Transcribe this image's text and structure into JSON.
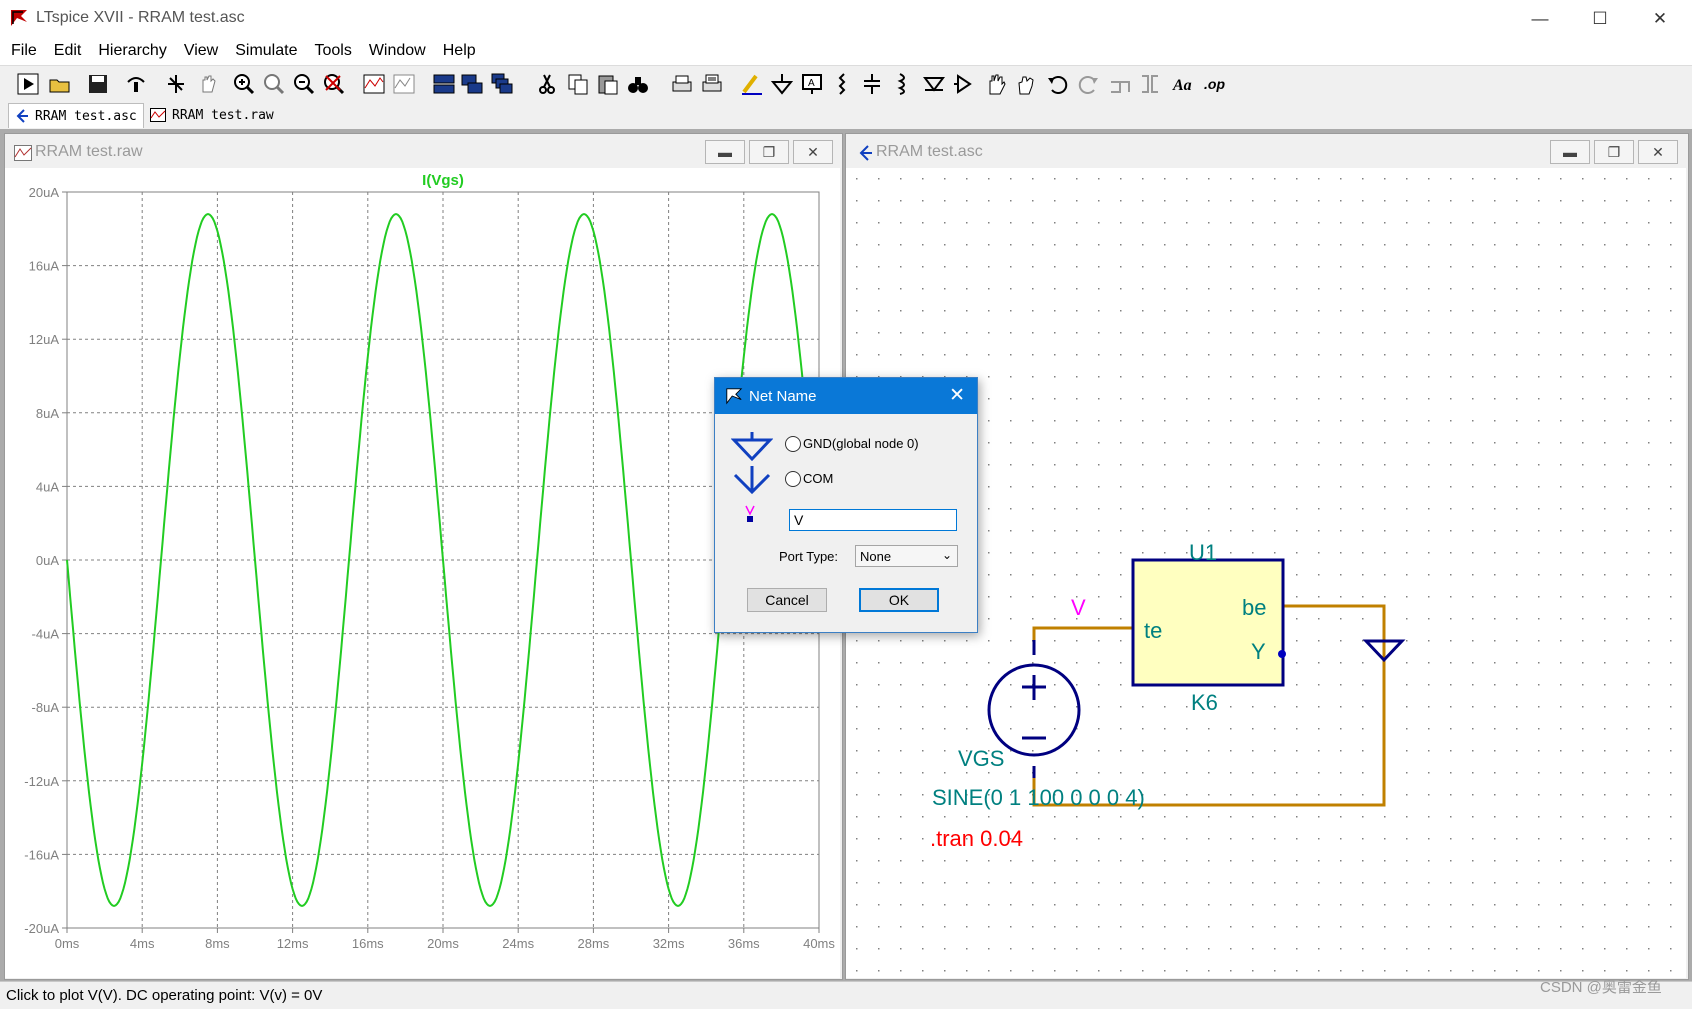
{
  "window": {
    "title": "LTspice XVII - RRAM test.asc",
    "minimize": "—",
    "maximize": "☐",
    "close": "✕"
  },
  "menu": [
    "File",
    "Edit",
    "Hierarchy",
    "View",
    "Simulate",
    "Tools",
    "Window",
    "Help"
  ],
  "toolbar_icons": [
    "run-icon",
    "open-icon",
    "save-icon",
    "control-panel-icon",
    "halt-icon",
    "pan-hand-icon",
    "zoom-in-icon",
    "zoom-area-icon",
    "zoom-out-icon",
    "zoom-cancel-icon",
    "autorange-icon",
    "mark-unused-icon",
    "tile-horizontal-icon",
    "tile-vertical-icon",
    "cascade-icon",
    "cut-icon",
    "copy-icon",
    "paste-icon",
    "find-icon",
    "print-icon",
    "print-setup-icon",
    "draw-wire-icon",
    "ground-icon",
    "label-net-icon",
    "resistor-icon",
    "capacitor-icon",
    "inductor-icon",
    "diode-icon",
    "component-icon",
    "move-icon",
    "drag-icon",
    "undo-icon",
    "redo-icon",
    "rotate-icon",
    "mirror-icon",
    "text-icon",
    "spice-directive-icon"
  ],
  "tabs": [
    {
      "label": "RRAM test.asc"
    },
    {
      "label": "RRAM test.raw"
    }
  ],
  "waveform_window": {
    "title": "RRAM test.raw",
    "trace_label": "I(Vgs)",
    "trace_color": "#22cc22"
  },
  "chart_data": {
    "type": "line",
    "title": "",
    "series": [
      {
        "name": "I(Vgs)",
        "x": [
          0,
          2.5,
          5,
          7.5,
          10,
          12.5,
          15,
          17.5,
          20,
          22.5,
          25,
          27.5,
          30,
          32.5,
          35,
          37.5,
          40
        ],
        "values": [
          0,
          -18.8,
          0,
          18.8,
          0,
          -18.8,
          0,
          18.8,
          0,
          -18.8,
          0,
          18.8,
          0,
          -18.8,
          0,
          18.8,
          0
        ]
      }
    ],
    "x_unit": "ms",
    "y_unit": "uA",
    "xlim": [
      0,
      40
    ],
    "ylim": [
      -20,
      20
    ],
    "x_ticks": [
      "0ms",
      "4ms",
      "8ms",
      "12ms",
      "16ms",
      "20ms",
      "24ms",
      "28ms",
      "32ms",
      "36ms",
      "40ms"
    ],
    "y_ticks": [
      "20uA",
      "16uA",
      "12uA",
      "8uA",
      "4uA",
      "0uA",
      "-4uA",
      "-8uA",
      "-12uA",
      "-16uA",
      "-20uA"
    ],
    "grid": true
  },
  "schematic_window": {
    "title": "RRAM test.asc",
    "component_name": "U1",
    "component_model": "K6",
    "pin_te": "te",
    "pin_be": "be",
    "pin_y": "Y",
    "net_label": "V",
    "source_name": "VGS",
    "source_value": "SINE(0 1 100 0 0 0 4)",
    "directive": ".tran 0.04",
    "colors": {
      "wire": "#c08000",
      "symbol": "#000080",
      "text": "#008080",
      "net_label": "#ff00ff",
      "directive": "#ff0000",
      "component_fill": "#ffffc0"
    }
  },
  "dialog": {
    "title": "Net Name",
    "close": "✕",
    "option_gnd": "GND(global node 0)",
    "option_com": "COM",
    "net_value": "V",
    "port_type_label": "Port Type:",
    "port_type_value": "None",
    "cancel": "Cancel",
    "ok": "OK"
  },
  "status": {
    "text": "Click to plot V(V).  DC operating point: V(v) = 0V",
    "watermark": "CSDN @奥雷金鱼"
  }
}
